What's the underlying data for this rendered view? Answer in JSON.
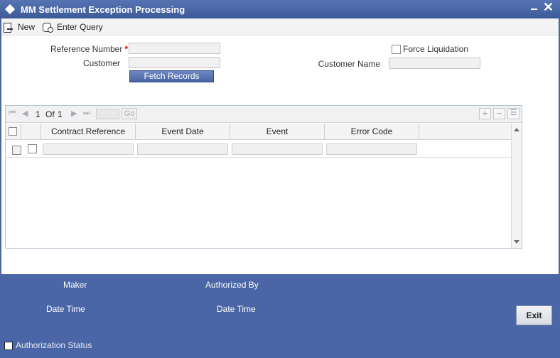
{
  "window": {
    "title": "MM Settlement Exception Processing"
  },
  "toolbar": {
    "new_label": "New",
    "enter_query_label": "Enter Query"
  },
  "form": {
    "reference_number_label": "Reference Number",
    "required_mark": "*",
    "customer_label": "Customer",
    "fetch_records_label": "Fetch Records",
    "force_liquidation_label": "Force Liquidation",
    "customer_name_label": "Customer Name"
  },
  "grid": {
    "pagination": {
      "current": "1",
      "of_label": "Of",
      "total": "1",
      "go_label": "Go"
    },
    "columns": [
      "Contract Reference",
      "Event Date",
      "Event",
      "Error Code"
    ],
    "add_icon": "plus-icon",
    "remove_icon": "minus-icon",
    "single_view_icon": "list-icon"
  },
  "footer": {
    "maker_label": "Maker",
    "maker_datetime_label": "Date Time",
    "authorized_by_label": "Authorized By",
    "authorized_datetime_label": "Date Time",
    "authorization_status_label": "Authorization Status",
    "exit_label": "Exit"
  },
  "colors": {
    "frame": "#4a66a6",
    "button": "#5674b3"
  }
}
